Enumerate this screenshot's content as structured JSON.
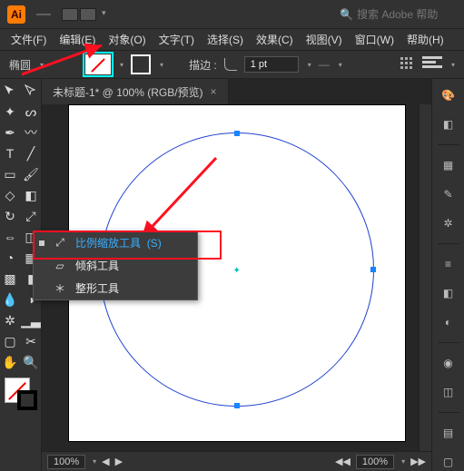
{
  "app": {
    "logo": "Ai"
  },
  "search": {
    "placeholder": "搜索 Adobe 帮助"
  },
  "menu": [
    "文件(F)",
    "编辑(E)",
    "对象(O)",
    "文字(T)",
    "选择(S)",
    "效果(C)",
    "视图(V)",
    "窗口(W)",
    "帮助(H)"
  ],
  "optbar": {
    "shape": "椭圆",
    "stroke_label": "描边 :",
    "stroke_weight": "1 pt"
  },
  "document": {
    "tab_title": "未标题-1* @ 100% (RGB/预览)"
  },
  "flyout": {
    "items": [
      {
        "label": "比例缩放工具",
        "shortcut": "(S)",
        "selected": true
      },
      {
        "label": "倾斜工具",
        "shortcut": "",
        "selected": false
      },
      {
        "label": "整形工具",
        "shortcut": "",
        "selected": false
      }
    ]
  },
  "status": {
    "zoom": "100%",
    "right_zoom": "100%"
  }
}
